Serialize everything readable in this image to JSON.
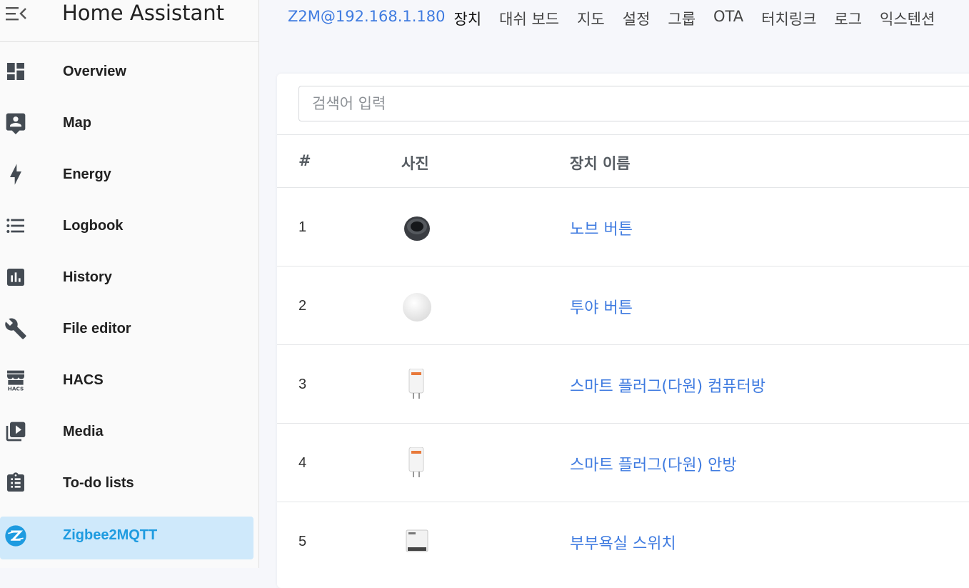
{
  "app": {
    "title": "Home Assistant"
  },
  "sidebar": {
    "items": [
      {
        "label": "Overview",
        "icon": "dashboard-icon"
      },
      {
        "label": "Map",
        "icon": "map-account-icon"
      },
      {
        "label": "Energy",
        "icon": "lightning-bolt-icon"
      },
      {
        "label": "Logbook",
        "icon": "format-list-icon"
      },
      {
        "label": "History",
        "icon": "chart-box-icon"
      },
      {
        "label": "File editor",
        "icon": "wrench-icon"
      },
      {
        "label": "HACS",
        "icon": "hacs-store-icon"
      },
      {
        "label": "Media",
        "icon": "play-box-multiple-icon"
      },
      {
        "label": "To-do lists",
        "icon": "clipboard-list-icon"
      },
      {
        "label": "Zigbee2MQTT",
        "icon": "zigbee-icon",
        "active": true
      }
    ]
  },
  "topnav": {
    "brand": "Z2M@192.168.1.180",
    "tabs": [
      "장치",
      "대쉬 보드",
      "지도",
      "설정",
      "그룹",
      "OTA",
      "터치링크",
      "로그",
      "익스텐션"
    ]
  },
  "search": {
    "placeholder": "검색어 입력"
  },
  "table": {
    "headers": {
      "num": "#",
      "photo": "사진",
      "name": "장치 이름"
    },
    "rows": [
      {
        "num": "1",
        "name": "노브 버튼",
        "photo": "knob-device-image"
      },
      {
        "num": "2",
        "name": "투야 버튼",
        "photo": "round-button-image"
      },
      {
        "num": "3",
        "name": "스마트 플러그(다원) 컴퓨터방",
        "photo": "smart-plug-image"
      },
      {
        "num": "4",
        "name": "스마트 플러그(다원) 안방",
        "photo": "smart-plug-image"
      },
      {
        "num": "5",
        "name": "부부욕실 스위치",
        "photo": "switch-module-image"
      }
    ]
  },
  "colors": {
    "accent": "#3f7be0",
    "active_bg": "#cfe9fb",
    "active_text": "#1e9be0"
  }
}
